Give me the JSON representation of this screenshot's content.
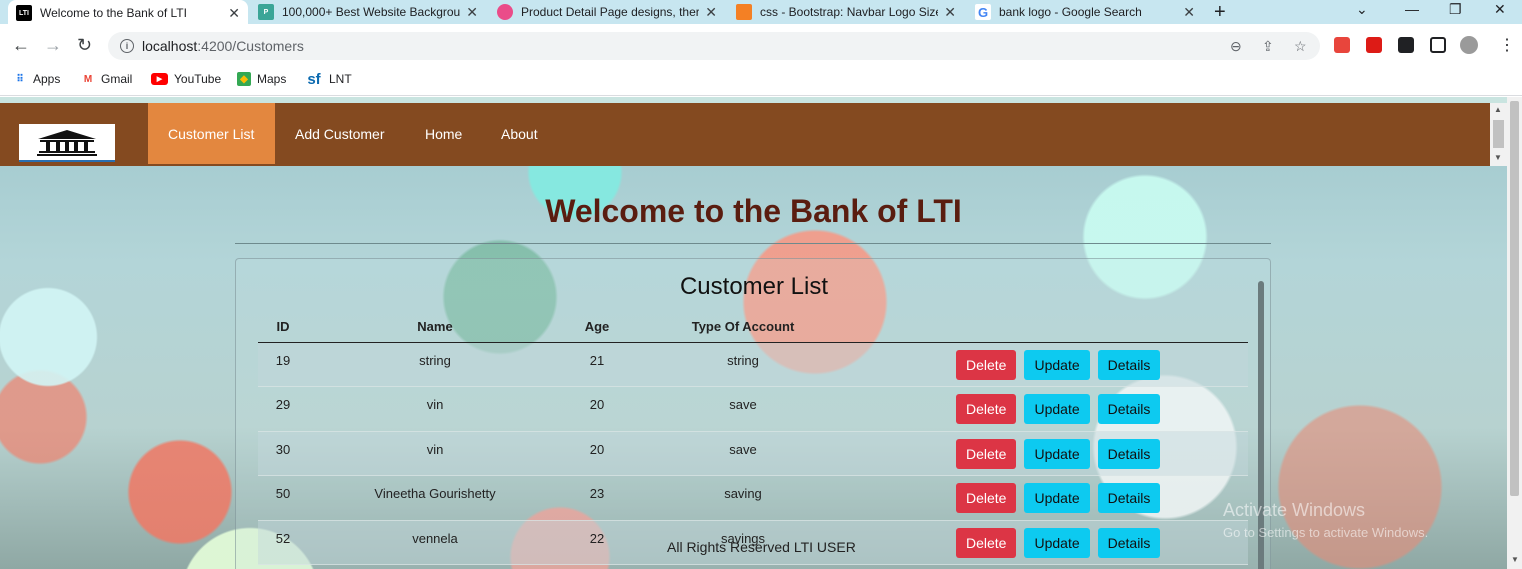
{
  "browser": {
    "tabs": [
      {
        "title": "Welcome to the Bank of LTI",
        "favicon_text": "LTI",
        "favicon_color": "#000000"
      },
      {
        "title": "100,000+ Best Website Backgrour",
        "favicon_text": "P",
        "favicon_color": "#3aa597"
      },
      {
        "title": "Product Detail Page designs, ther",
        "favicon_text": "",
        "favicon_color": "#ea4c89"
      },
      {
        "title": "css - Bootstrap: Navbar Logo Size",
        "favicon_text": "",
        "favicon_color": "#f48024"
      },
      {
        "title": "bank logo - Google Search",
        "favicon_text": "G",
        "favicon_color": "#4285f4"
      }
    ],
    "url_host": "localhost",
    "url_path": ":4200/Customers",
    "bookmarks": [
      {
        "label": "Apps",
        "icon": "apps-grid-icon"
      },
      {
        "label": "Gmail",
        "icon": "gmail-icon"
      },
      {
        "label": "YouTube",
        "icon": "youtube-icon"
      },
      {
        "label": "Maps",
        "icon": "maps-icon"
      },
      {
        "label": "LNT",
        "icon": "sf-icon"
      }
    ]
  },
  "navbar": {
    "items": [
      {
        "label": "Customer List",
        "active": true
      },
      {
        "label": "Add Customer",
        "active": false
      },
      {
        "label": "Home",
        "active": false
      },
      {
        "label": "About",
        "active": false
      }
    ],
    "bg_color": "#844a20",
    "active_color": "#e3873f"
  },
  "page": {
    "welcome": "Welcome to the Bank of LTI",
    "card_title": "Customer List",
    "footer": "All Rights Reserved LTI USER"
  },
  "table": {
    "headers": [
      "ID",
      "Name",
      "Age",
      "Type Of Account",
      ""
    ],
    "rows": [
      {
        "id": "19",
        "name": "string",
        "age": "21",
        "type": "string"
      },
      {
        "id": "29",
        "name": "vin",
        "age": "20",
        "type": "save"
      },
      {
        "id": "30",
        "name": "vin",
        "age": "20",
        "type": "save"
      },
      {
        "id": "50",
        "name": "Vineetha Gourishetty",
        "age": "23",
        "type": "saving"
      },
      {
        "id": "52",
        "name": "vennela",
        "age": "22",
        "type": "savings"
      }
    ],
    "actions": {
      "delete": "Delete",
      "update": "Update",
      "details": "Details"
    }
  },
  "watermark": {
    "line1": "Activate Windows",
    "line2": "Go to Settings to activate Windows."
  }
}
